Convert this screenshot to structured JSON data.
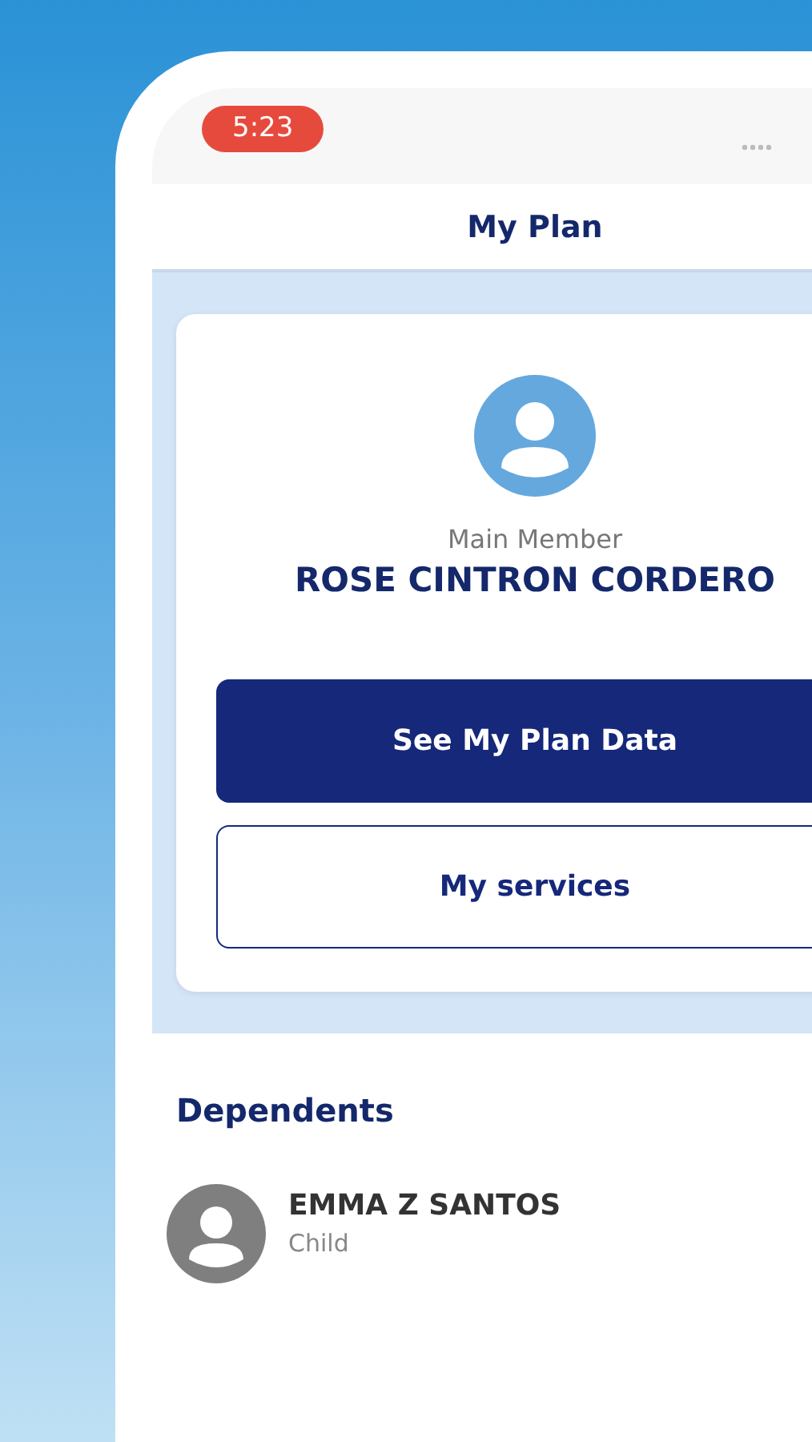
{
  "status_bar": {
    "time": "5:23"
  },
  "header": {
    "title": "My Plan"
  },
  "member": {
    "role": "Main Member",
    "name": "ROSE CINTRON CORDERO"
  },
  "buttons": [
    {
      "label": "See My Plan Data",
      "kind": "primary"
    },
    {
      "label": "My services",
      "kind": "outline"
    }
  ],
  "dependents": {
    "title": "Dependents",
    "items": [
      {
        "name": "EMMA Z SANTOS",
        "relation": "Child"
      }
    ]
  }
}
